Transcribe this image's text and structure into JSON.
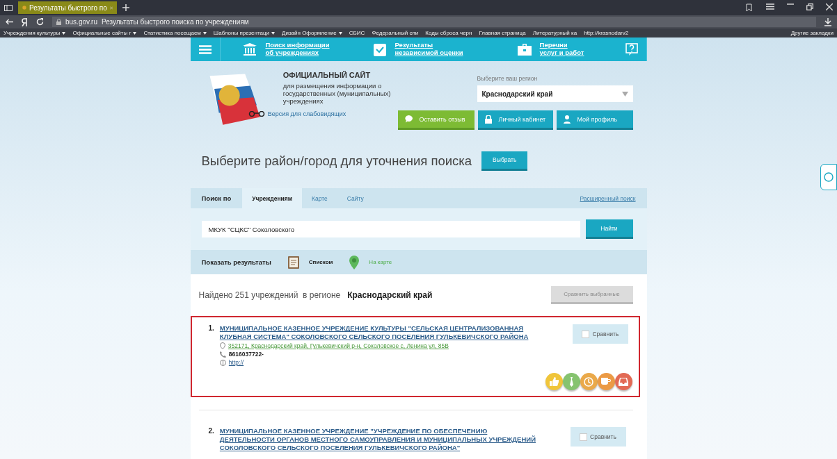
{
  "browser": {
    "tab_title": "Результаты быстрого по",
    "domain": "bus.gov.ru",
    "page_title": "Результаты быстрого поиска по учреждениям",
    "bookmarks": [
      {
        "label": "Учреждения культуры",
        "folder": true
      },
      {
        "label": "Официальные сайты г",
        "folder": true
      },
      {
        "label": "Статистика посещаем",
        "folder": true
      },
      {
        "label": "Шаблоны презентаци",
        "folder": true
      },
      {
        "label": "Дизайн Оформление",
        "folder": true
      },
      {
        "label": "СБИС",
        "folder": false
      },
      {
        "label": "Федеральный спи",
        "folder": false
      },
      {
        "label": "Коды сброса черн",
        "folder": false
      },
      {
        "label": "Главная страница",
        "folder": false
      },
      {
        "label": "Литературный ка",
        "folder": false
      },
      {
        "label": "http://krasnodarv2",
        "folder": false
      }
    ],
    "other_bookmarks": "Другие закладки"
  },
  "nav": {
    "items": [
      {
        "kind": "building",
        "line1": "Поиск информации",
        "line2": "об учреждениях"
      },
      {
        "kind": "check",
        "line1": "Результаты",
        "line2": "независимой оценки"
      },
      {
        "kind": "case",
        "line1": "Перечни",
        "line2": "услуг и работ"
      }
    ]
  },
  "header": {
    "title": "ОФИЦИАЛЬНЫЙ САЙТ",
    "subtitle": "для размещения информации о государственных (муниципальных) учреждениях",
    "low_vision": "Версия для слабовидящих",
    "region_label": "Выберите ваш регион",
    "region_value": "Краснодарский край",
    "buttons": [
      {
        "kind": "feedback",
        "label": "Оставить отзыв"
      },
      {
        "kind": "cabinet",
        "label": "Личный кабинет"
      },
      {
        "kind": "profile",
        "label": "Мой профиль"
      }
    ]
  },
  "district": {
    "prompt": "Выберите район/город для уточнения поиска",
    "button": "Выбрать"
  },
  "search": {
    "prefix": "Поиск по",
    "tabs": [
      {
        "label": "Учреждениям",
        "selected": true
      },
      {
        "label": "Карте",
        "selected": false
      },
      {
        "label": "Сайту",
        "selected": false
      }
    ],
    "advanced": "Расширенный поиск",
    "value": "МКУК \"СЦКС\" Соколовского",
    "button": "Найти"
  },
  "show_results": {
    "label": "Показать результаты",
    "options": [
      {
        "kind": "list",
        "label": "Списком",
        "selected": true
      },
      {
        "kind": "map",
        "label": "На карте",
        "selected": false
      }
    ]
  },
  "results": {
    "found": "Найдено 251 учреждений  в регионе",
    "region": "Краснодарский край",
    "compare_selected": {
      "label": "Сравнить выбранные",
      "disabled": true
    },
    "items": [
      {
        "number": "1.",
        "name": "МУНИЦИПАЛЬНОЕ КАЗЕННОЕ УЧРЕЖДЕНИЕ КУЛЬТУРЫ \"СЕЛЬСКАЯ ЦЕНТРАЛИЗОВАННАЯ КЛУБНАЯ СИСТЕМА\" СОКОЛОВСКОГО СЕЛЬСКОГО ПОСЕЛЕНИЯ ГУЛЬКЕВИЧСКОГО РАЙОНА",
        "address": "352171, Краснодарский край, Гулькевичский р-н, Соколовское с, Ленина ул, 85В",
        "phone": "8616037722-",
        "website": "http://",
        "compare": "Сравнить",
        "checked": false,
        "highlighted": true,
        "badges": [
          {
            "kind": "thumb",
            "color": "#f0c53a"
          },
          {
            "kind": "tie",
            "color": "#86c36f"
          },
          {
            "kind": "clock",
            "color": "#eaa94a"
          },
          {
            "kind": "cup",
            "color": "#eb9a45"
          },
          {
            "kind": "tray",
            "color": "#e26a55"
          }
        ]
      },
      {
        "number": "2.",
        "name": "МУНИЦИПАЛЬНОЕ КАЗЕННОЕ УЧРЕЖДЕНИЕ \"УЧРЕЖДЕНИЕ ПО ОБЕСПЕЧЕНИЮ ДЕЯТЕЛЬНОСТИ ОРГАНОВ МЕСТНОГО САМОУПРАВЛЕНИЯ И МУНИЦИПАЛЬНЫХ УЧРЕЖДЕНИЙ СОКОЛОВСКОГО СЕЛЬСКОГО ПОСЕЛЕНИЯ ГУЛЬКЕВИЧСКОГО РАЙОНА\"",
        "compare": "Сравнить",
        "checked": false,
        "highlighted": false
      }
    ]
  }
}
